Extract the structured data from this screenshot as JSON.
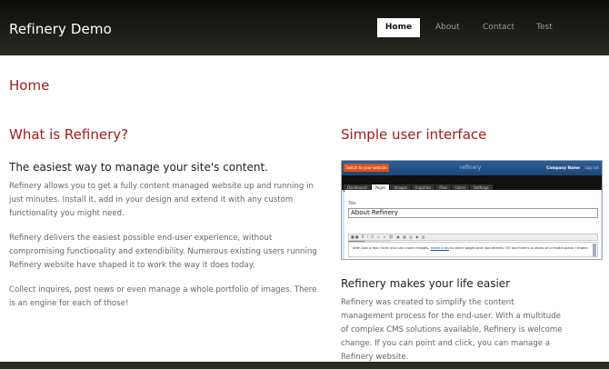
{
  "header": {
    "site_title": "Refinery Demo",
    "nav": [
      {
        "label": "Home",
        "active": true
      },
      {
        "label": "About"
      },
      {
        "label": "Contact"
      },
      {
        "label": "Test"
      }
    ]
  },
  "page": {
    "title": "Home"
  },
  "left": {
    "heading": "What is Refinery?",
    "subheading": "The easiest way to manage your site's content.",
    "paragraphs": [
      "Refinery allows you to get a fully content managed website up and running in just minutes. Install it, add in your design and extend it with any custom functionality you might need.",
      "Refinery delivers the easiest possible end-user experience, without compromising functionality and extendibility. Numerous existing users running Refinery website have shaped it to work the way it does today.",
      "Collect inquires, post news or even manage a whole portfolio of images. There is an engine for each of those!"
    ]
  },
  "right": {
    "heading": "Simple user interface",
    "screenshot": {
      "switch_label": "Switch to your website",
      "logo": "refinery",
      "company": "Company Name",
      "logout": "Log out",
      "tabs": [
        "Dashboard",
        "Pages",
        "Images",
        "Inquiries",
        "Files",
        "Users",
        "Settings"
      ],
      "title_label": "Title",
      "title_value": "About Refinery",
      "edit_tabs": [
        "Body",
        "Side Body"
      ],
      "editor_text_before": "With just a few clicks you can insert images,",
      "editor_link": "make links",
      "editor_text_after": "to other pages and documents. Oh and here's a photo of a model plane I made:"
    },
    "subheading": "Refinery makes your life easier",
    "paragraph": "Refinery was created to simplify the content management process for the end-user. With a multitude of complex CMS solutions available, Refinery is welcome change. If you can point and click, you can manage a Refinery website."
  }
}
